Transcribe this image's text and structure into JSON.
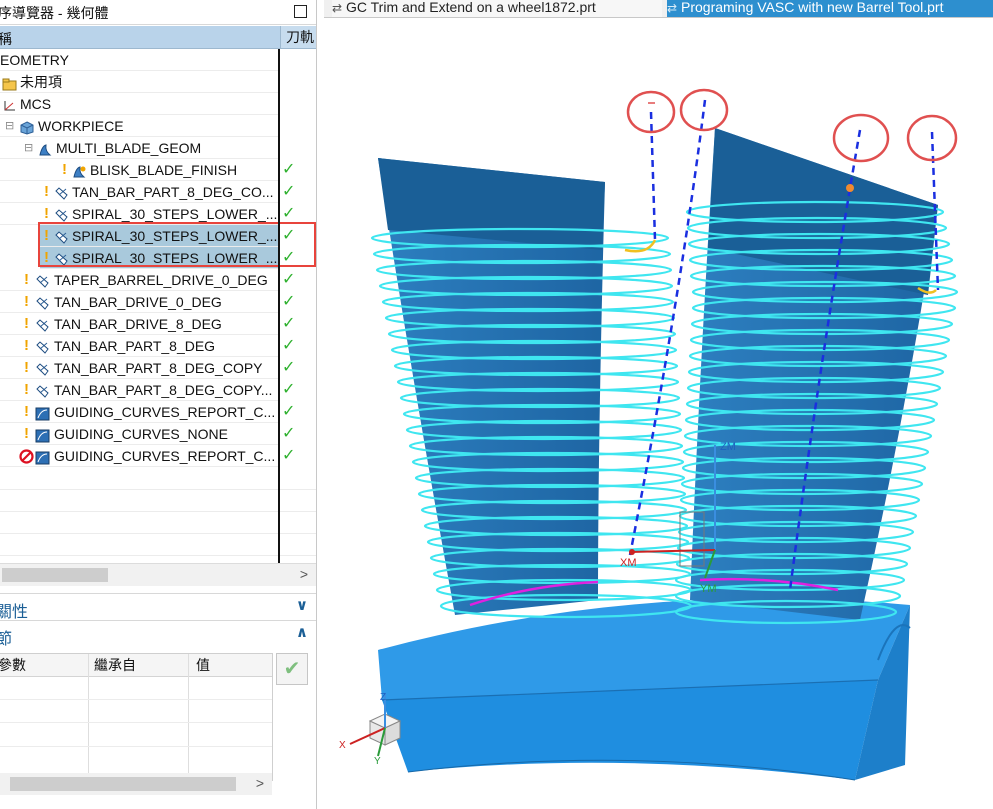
{
  "navigator": {
    "title": "序導覽器 - 幾何體",
    "col_name": "稱",
    "col_toolpath": "刀軌"
  },
  "tree": [
    {
      "label": "EOMETRY"
    },
    {
      "label": "未用項"
    },
    {
      "label": "MCS"
    },
    {
      "label": "WORKPIECE"
    },
    {
      "label": "MULTI_BLADE_GEOM"
    },
    {
      "label": "BLISK_BLADE_FINISH",
      "status": "✓"
    },
    {
      "label": "TAN_BAR_PART_8_DEG_CO...",
      "status": "✓"
    },
    {
      "label": "SPIRAL_30_STEPS_LOWER_...",
      "status": "✓"
    },
    {
      "label": "SPIRAL_30_STEPS_LOWER_...",
      "status": "✓"
    },
    {
      "label": "SPIRAL_30_STEPS_LOWER_...",
      "status": "✓"
    },
    {
      "label": "TAPER_BARREL_DRIVE_0_DEG",
      "status": "✓"
    },
    {
      "label": "TAN_BAR_DRIVE_0_DEG",
      "status": "✓"
    },
    {
      "label": "TAN_BAR_DRIVE_8_DEG",
      "status": "✓"
    },
    {
      "label": "TAN_BAR_PART_8_DEG",
      "status": "✓"
    },
    {
      "label": "TAN_BAR_PART_8_DEG_COPY",
      "status": "✓"
    },
    {
      "label": "TAN_BAR_PART_8_DEG_COPY...",
      "status": "✓"
    },
    {
      "label": "GUIDING_CURVES_REPORT_C...",
      "status": "✓"
    },
    {
      "label": "GUIDING_CURVES_NONE",
      "status": "✓"
    },
    {
      "label": "GUIDING_CURVES_REPORT_C...",
      "status": "✓"
    }
  ],
  "sections": {
    "dependencies": "關性",
    "details": "節"
  },
  "param_table": {
    "col_param": "參數",
    "col_inherit": "繼承自",
    "col_value": "值"
  },
  "tabs": {
    "tab1": "GC Trim and Extend on a wheel1872.prt",
    "tab2": "Programing VASC with new Barrel Tool.prt"
  },
  "axes": {
    "z": "Z",
    "x": "X",
    "y": "Y",
    "zm": "ZM",
    "xm": "XM",
    "ym": "YM"
  },
  "colors": {
    "accent": "#2d8fcf",
    "selection": "#a9c9dc",
    "highlight_box": "#e8443c",
    "toolpath": "#39e2ee",
    "blade": "#2473b5",
    "hub": "#2b93e0"
  }
}
